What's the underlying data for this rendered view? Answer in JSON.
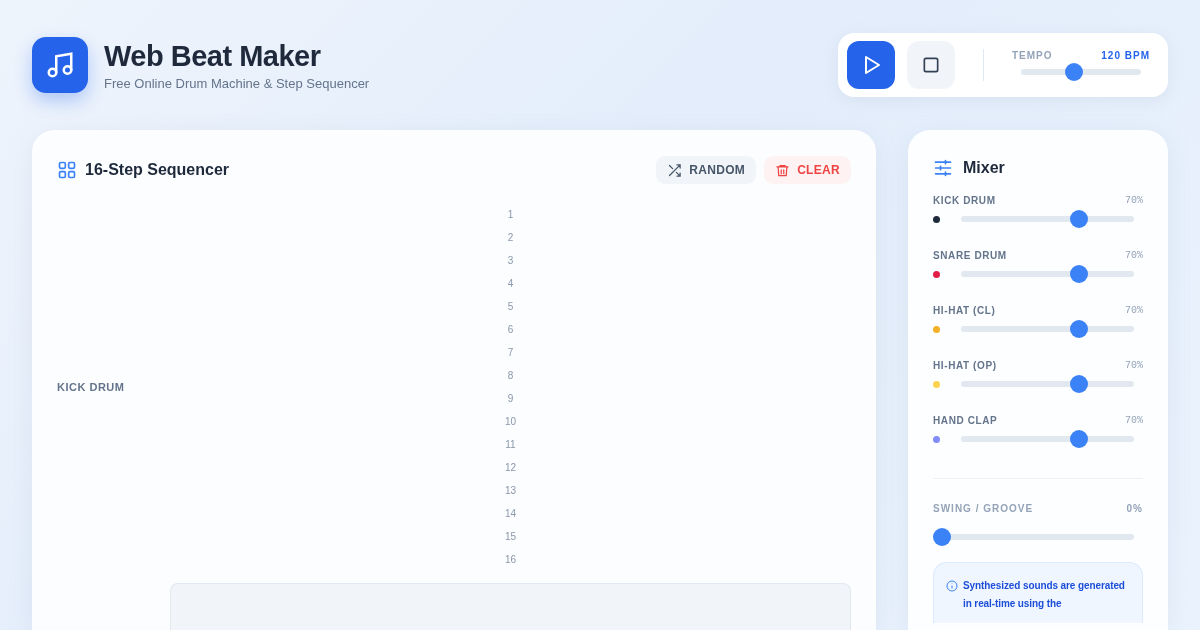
{
  "header": {
    "title": "Web Beat Maker",
    "subtitle": "Free Online Drum Machine & Step Sequencer"
  },
  "transport": {
    "tempo": {
      "label": "TEMPO",
      "reading": "120 BPM",
      "level": 0.44
    }
  },
  "sequencer": {
    "title": "16-Step Sequencer",
    "buttons": [
      {
        "kind": "random",
        "label": "RANDOM"
      },
      {
        "kind": "clear",
        "label": "CLEAR"
      }
    ],
    "step_numbers": [
      "1",
      "2",
      "3",
      "4",
      "5",
      "6",
      "7",
      "8",
      "9",
      "10",
      "11",
      "12",
      "13",
      "14",
      "15",
      "16"
    ],
    "tracks": [
      {
        "name": "KICK DRUM"
      }
    ]
  },
  "mixer": {
    "title": "Mixer",
    "channels": [
      {
        "name": "KICK DRUM",
        "reading": "70%",
        "level": 0.68,
        "color": "#1e293b"
      },
      {
        "name": "SNARE DRUM",
        "reading": "70%",
        "level": 0.68,
        "color": "#e11d48"
      },
      {
        "name": "HI-HAT (CL)",
        "reading": "70%",
        "level": 0.68,
        "color": "#f5b027"
      },
      {
        "name": "HI-HAT (OP)",
        "reading": "70%",
        "level": 0.68,
        "color": "#fcd34d"
      },
      {
        "name": "HAND CLAP",
        "reading": "70%",
        "level": 0.68,
        "color": "#818cf8"
      }
    ],
    "swing": {
      "label": "SWING / GROOVE",
      "reading": "0%",
      "level": 0
    },
    "info": "Synthesized sounds are generated in real-time using the"
  }
}
